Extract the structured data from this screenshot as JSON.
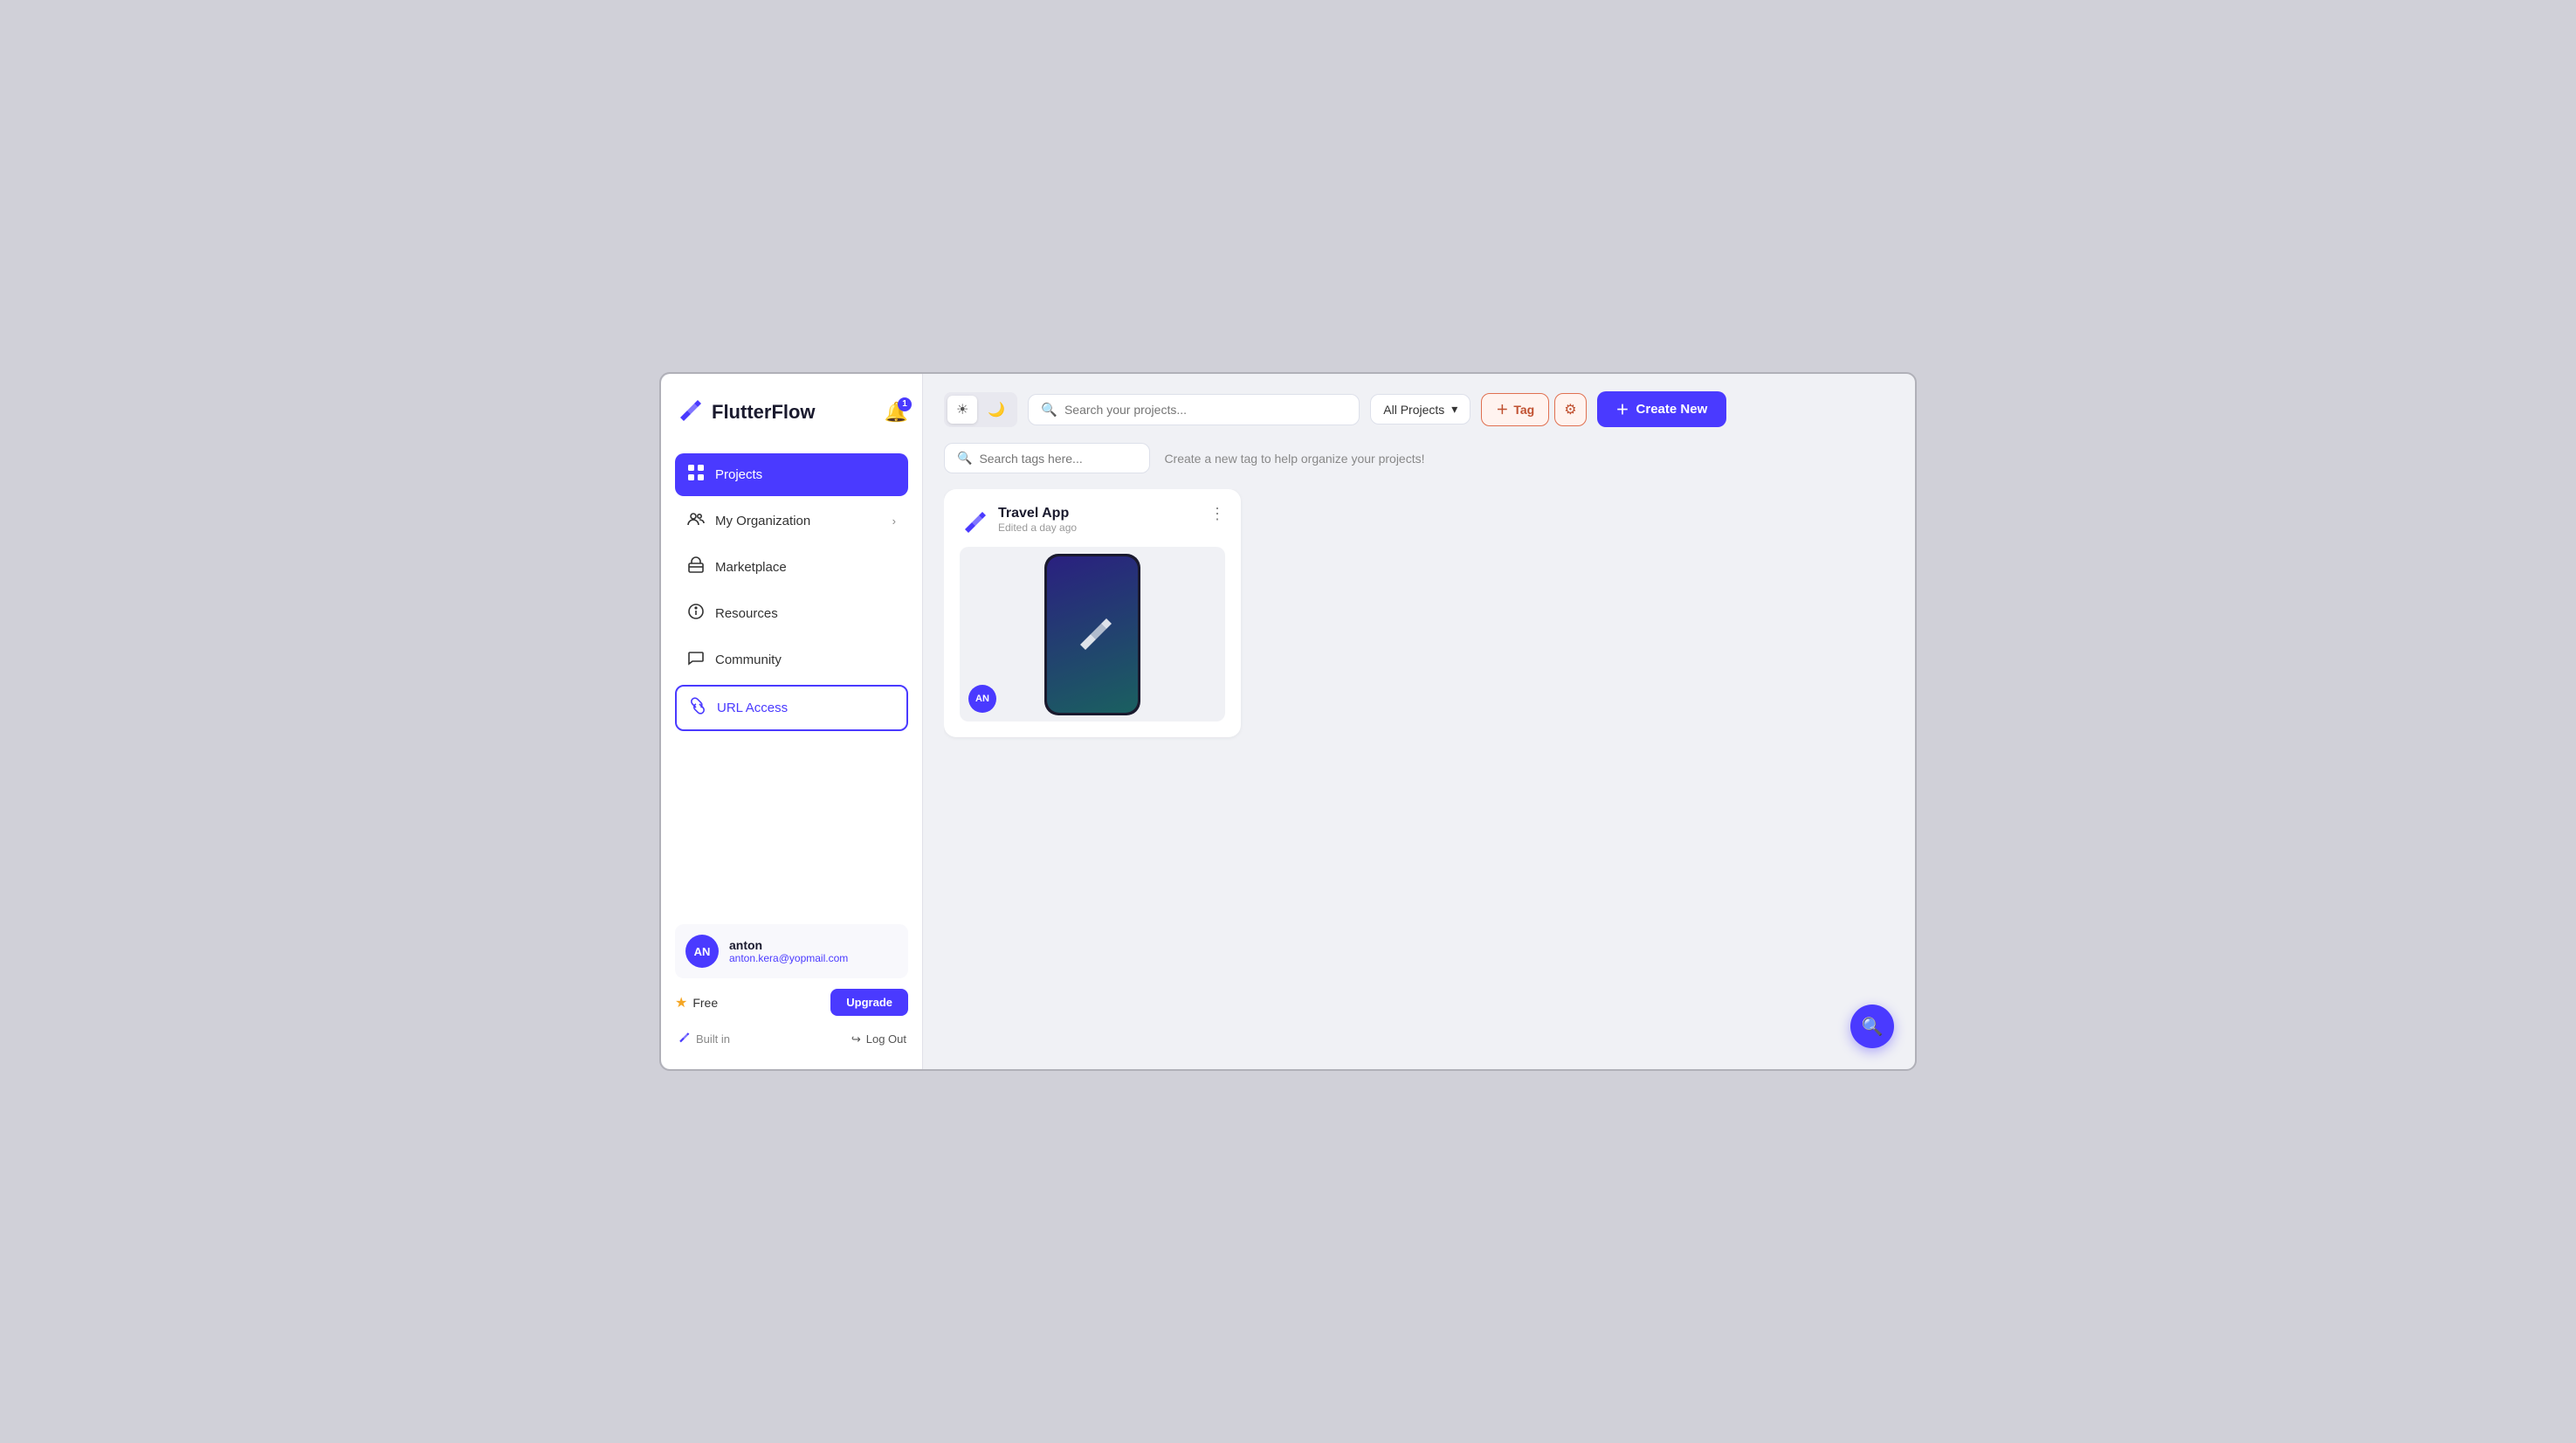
{
  "app": {
    "name": "FlutterFlow",
    "bell_badge": "1"
  },
  "sidebar": {
    "nav_items": [
      {
        "id": "projects",
        "label": "Projects",
        "icon": "⊞",
        "active": true,
        "selected": false
      },
      {
        "id": "my-organization",
        "label": "My Organization",
        "icon": "👥",
        "active": false,
        "selected": false,
        "has_chevron": true
      },
      {
        "id": "marketplace",
        "label": "Marketplace",
        "icon": "🏪",
        "active": false,
        "selected": false
      },
      {
        "id": "resources",
        "label": "Resources",
        "icon": "❓",
        "active": false,
        "selected": false
      },
      {
        "id": "community",
        "label": "Community",
        "icon": "💬",
        "active": false,
        "selected": false
      },
      {
        "id": "url-access",
        "label": "URL Access",
        "icon": "🔗",
        "active": false,
        "selected": true
      }
    ],
    "user": {
      "initials": "AN",
      "name": "anton",
      "email": "anton.kera@yopmail.com"
    },
    "plan": {
      "label": "Free",
      "upgrade_label": "Upgrade"
    },
    "built_in_label": "Built in",
    "logout_label": "Log Out"
  },
  "topbar": {
    "theme_light_icon": "☀",
    "theme_dark_icon": "🌙",
    "search_placeholder": "Search your projects...",
    "filter_label": "All Projects",
    "tag_label": "Tag",
    "create_label": "Create New"
  },
  "tags_bar": {
    "search_placeholder": "Search tags here...",
    "hint": "Create a new tag to help organize your projects!"
  },
  "projects": [
    {
      "id": "travel-app",
      "title": "Travel App",
      "subtitle": "Edited a day ago",
      "avatar_initials": "AN"
    }
  ],
  "fab": {
    "icon": "🔍"
  }
}
